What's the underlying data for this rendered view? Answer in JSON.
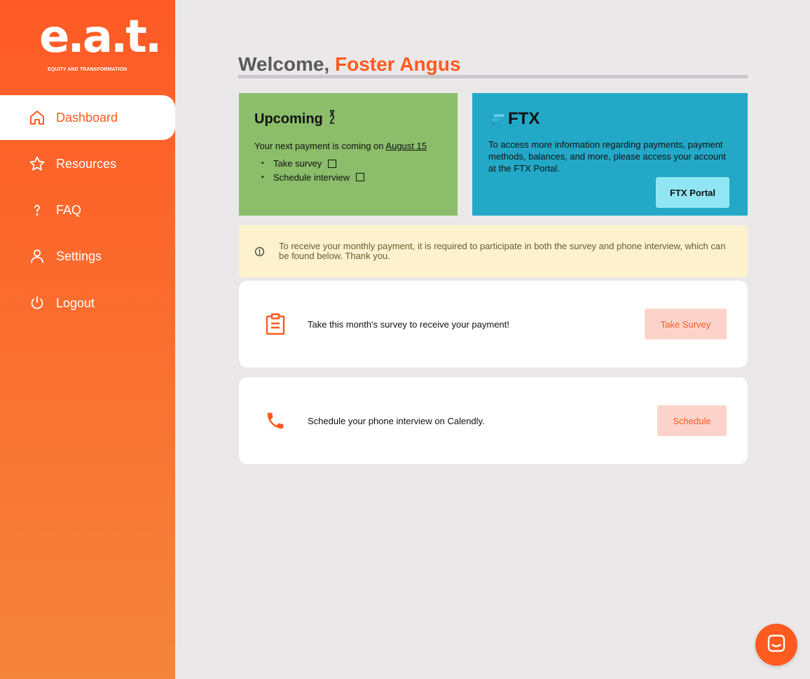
{
  "brand": {
    "logo_text": "e.a.t.",
    "logo_subtext": "EQUITY AND TRANSFORMATION",
    "accent_color": "#ff5a1f"
  },
  "sidebar": {
    "items": [
      {
        "label": "Dashboard",
        "icon": "home-icon",
        "active": true
      },
      {
        "label": "Resources",
        "icon": "star-icon",
        "active": false
      },
      {
        "label": "FAQ",
        "icon": "question-icon",
        "active": false
      },
      {
        "label": "Settings",
        "icon": "user-icon",
        "active": false
      },
      {
        "label": "Logout",
        "icon": "power-icon",
        "active": false
      }
    ]
  },
  "header": {
    "welcome_prefix": "Welcome,",
    "user_name": "Foster Angus"
  },
  "upcoming": {
    "title": "Upcoming",
    "icon": "hourglass-icon",
    "payment_text": "Your next payment is coming on",
    "payment_date": "August 15",
    "tasks": [
      {
        "label": "Take survey",
        "checked": false
      },
      {
        "label": "Schedule interview",
        "checked": false
      }
    ]
  },
  "ftx": {
    "title": "FTX",
    "description": "To access more information regarding payments, payment methods, balances, and more, please access your account at the FTX Portal.",
    "button_label": "FTX Portal"
  },
  "alert": {
    "icon": "info-circle-icon",
    "text": "To receive your monthly payment, it is required to participate in both the survey and phone interview, which can be found below. Thank you."
  },
  "tasks": {
    "survey": {
      "icon": "clipboard-icon",
      "text": "Take this month's survey to receive your payment!",
      "button_label": "Take Survey"
    },
    "interview": {
      "icon": "phone-icon",
      "text": "Schedule your phone interview on Calendly.",
      "button_label": "Schedule"
    }
  },
  "chat": {
    "icon": "chat-icon"
  }
}
